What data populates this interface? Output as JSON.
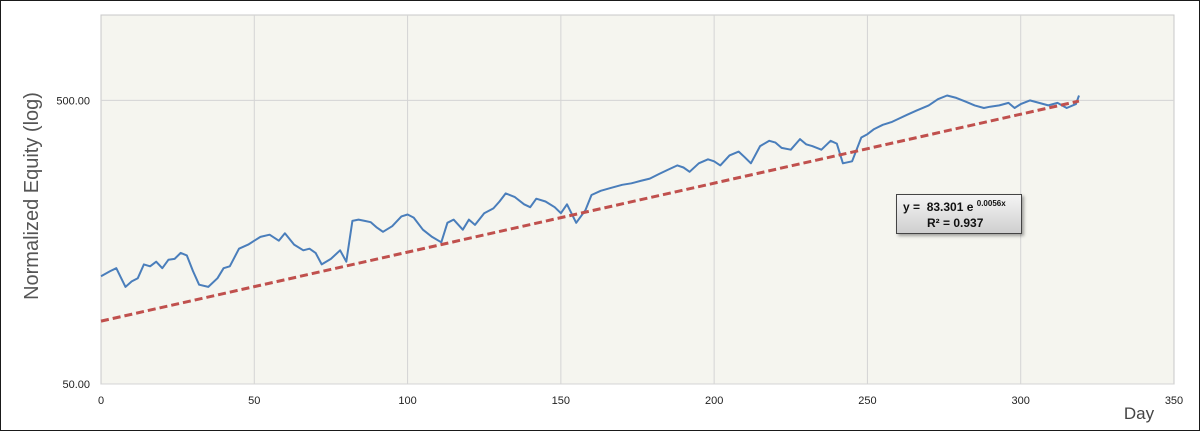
{
  "chart_data": {
    "type": "line",
    "ylabel": "Normalized Equity (log)",
    "xlabel": "Day",
    "xlim": [
      0,
      350
    ],
    "ylim": [
      50,
      1000
    ],
    "yscale": "log",
    "x_ticks": [
      "0",
      "50",
      "100",
      "150",
      "200",
      "250",
      "300",
      "350"
    ],
    "y_ticks": [
      "50.00",
      "500.00"
    ],
    "grid": true,
    "trendline": {
      "type": "exponential",
      "a": 83.301,
      "b": 0.0056,
      "equation_label": "83.301 e",
      "exponent_label": "0.0056x",
      "r2_label": "R² = 0.937",
      "y_prefix": "y  ="
    },
    "series": [
      {
        "x": [
          0,
          3,
          5,
          8,
          10,
          12,
          14,
          16,
          18,
          20,
          22,
          24,
          26,
          28,
          30,
          32,
          35,
          38,
          40,
          42,
          45,
          48,
          50,
          52,
          55,
          58,
          60,
          63,
          66,
          68,
          70,
          72,
          75,
          78,
          80,
          82,
          84,
          86,
          88,
          90,
          92,
          95,
          98,
          100,
          102,
          105,
          108,
          111,
          113,
          115,
          118,
          120,
          122,
          125,
          128,
          130,
          132,
          135,
          138,
          140,
          142,
          145,
          148,
          150,
          152,
          155,
          158,
          160,
          163,
          166,
          170,
          173,
          176,
          179,
          182,
          185,
          188,
          190,
          192,
          195,
          198,
          200,
          202,
          205,
          208,
          210,
          212,
          215,
          218,
          220,
          222,
          225,
          228,
          230,
          232,
          235,
          238,
          240,
          242,
          245,
          248,
          250,
          252,
          255,
          258,
          260,
          263,
          266,
          270,
          273,
          276,
          279,
          282,
          285,
          288,
          290,
          293,
          296,
          298,
          300,
          303,
          306,
          309,
          312,
          315,
          318,
          319
        ],
        "y": [
          120,
          125,
          128,
          110,
          115,
          118,
          132,
          130,
          135,
          128,
          137,
          138,
          145,
          142,
          125,
          112,
          110,
          118,
          128,
          130,
          150,
          155,
          160,
          165,
          168,
          160,
          170,
          155,
          148,
          150,
          145,
          132,
          138,
          148,
          135,
          188,
          190,
          188,
          186,
          178,
          172,
          180,
          195,
          198,
          193,
          175,
          165,
          158,
          185,
          190,
          175,
          190,
          182,
          200,
          208,
          220,
          235,
          228,
          215,
          210,
          225,
          220,
          210,
          200,
          215,
          185,
          205,
          232,
          240,
          245,
          252,
          255,
          260,
          265,
          275,
          285,
          295,
          290,
          280,
          300,
          310,
          305,
          295,
          320,
          330,
          315,
          300,
          345,
          360,
          355,
          340,
          335,
          365,
          350,
          345,
          335,
          360,
          352,
          300,
          305,
          370,
          380,
          395,
          410,
          420,
          430,
          445,
          460,
          480,
          505,
          520,
          510,
          495,
          480,
          470,
          475,
          480,
          490,
          470,
          485,
          500,
          490,
          480,
          490,
          470,
          485,
          520
        ]
      }
    ]
  }
}
